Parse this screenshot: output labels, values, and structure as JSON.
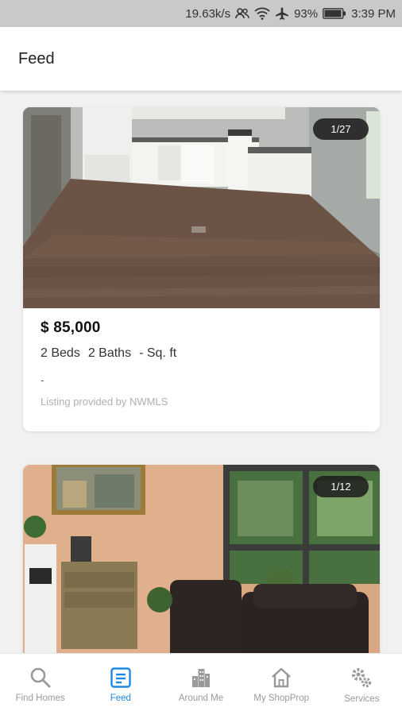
{
  "status_bar": {
    "network_speed": "19.63k/s",
    "battery": "93%",
    "time": "3:39 PM"
  },
  "app_bar": {
    "title": "Feed"
  },
  "listings": [
    {
      "photo_counter": "1/27",
      "price": "$ 85,000",
      "beds": "2 Beds",
      "baths": "2 Baths",
      "sqft": "- Sq. ft",
      "address": "-",
      "provider": "Listing provided by NWMLS"
    },
    {
      "photo_counter": "1/12"
    }
  ],
  "bottom_nav": {
    "items": [
      {
        "label": "Find Homes",
        "icon": "search-icon"
      },
      {
        "label": "Feed",
        "icon": "feed-icon",
        "active": true
      },
      {
        "label": "Around Me",
        "icon": "city-icon"
      },
      {
        "label": "My ShopProp",
        "icon": "home-icon"
      },
      {
        "label": "Services",
        "icon": "gears-icon"
      }
    ]
  },
  "colors": {
    "accent": "#1e88e5",
    "status_bar_bg": "#c9c9c9",
    "page_bg": "#f1f1f1"
  }
}
